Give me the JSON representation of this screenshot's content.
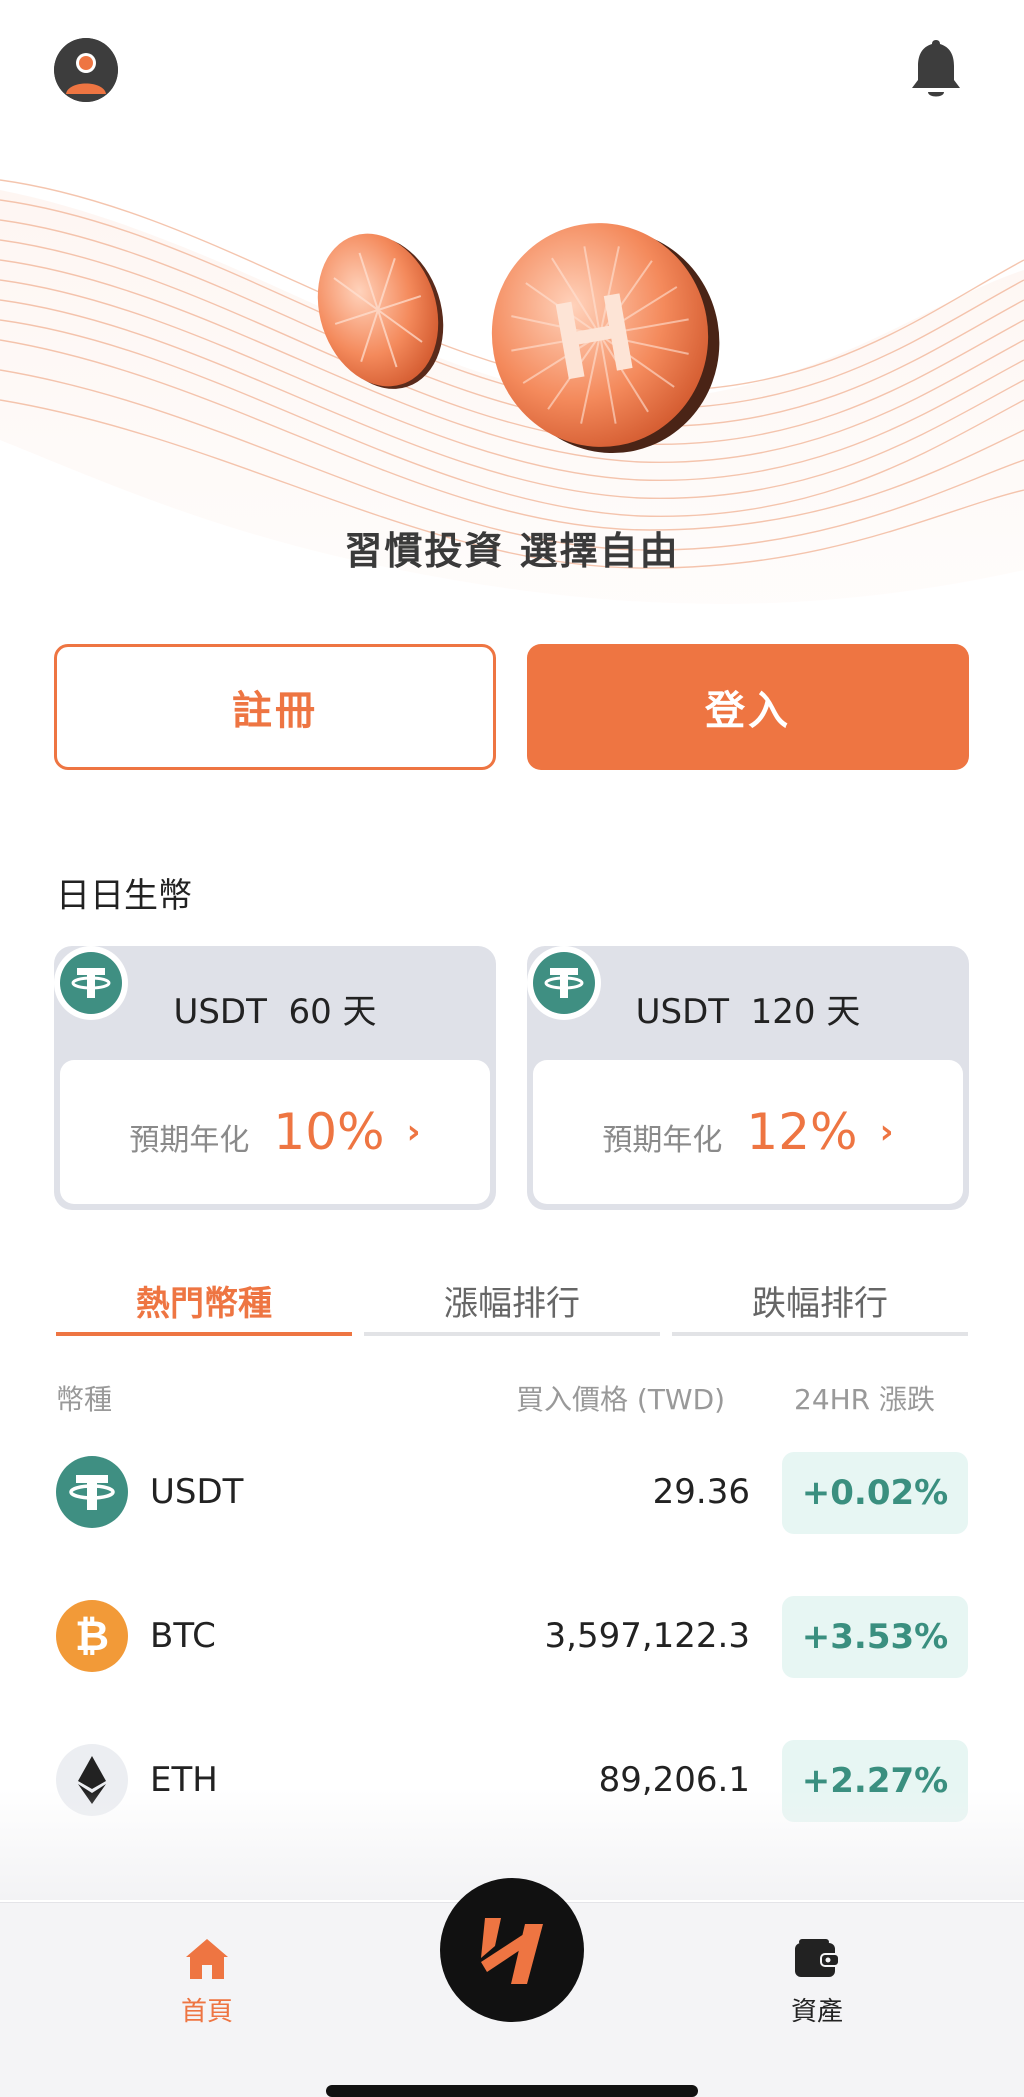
{
  "header": {
    "avatar_icon": "user-avatar-icon",
    "bell_icon": "bell-icon"
  },
  "hero": {
    "slogan": "習慣投資 選擇自由",
    "coin_letter": "H"
  },
  "auth": {
    "register_label": "註冊",
    "login_label": "登入"
  },
  "staking": {
    "title": "日日生幣",
    "cards": [
      {
        "title": "USDT  60 天",
        "label": "預期年化",
        "rate": "10%",
        "chevron": "›"
      },
      {
        "title": "USDT  120 天",
        "label": "預期年化",
        "rate": "12%",
        "chevron": "›"
      }
    ]
  },
  "market": {
    "tabs": [
      "熱門幣種",
      "漲幅排行",
      "跌幅排行"
    ],
    "active_tab": 0,
    "columns": {
      "coin": "幣種",
      "price": "買入價格 (TWD)",
      "change": "24HR 漲跌"
    },
    "rows": [
      {
        "symbol": "USDT",
        "price": "29.36",
        "change": "+0.02%",
        "icon": "tether-icon"
      },
      {
        "symbol": "BTC",
        "price": "3,597,122.3",
        "change": "+3.53%",
        "icon": "bitcoin-icon"
      },
      {
        "symbol": "ETH",
        "price": "89,206.1",
        "change": "+2.27%",
        "icon": "ethereum-icon"
      }
    ]
  },
  "bottom_nav": {
    "home_label": "首頁",
    "assets_label": "資產"
  },
  "colors": {
    "accent": "#ee7542",
    "positive": "#3a8f7f",
    "positive_bg": "#e7f6f3",
    "tether": "#3f8f82",
    "bitcoin": "#f29a38"
  }
}
